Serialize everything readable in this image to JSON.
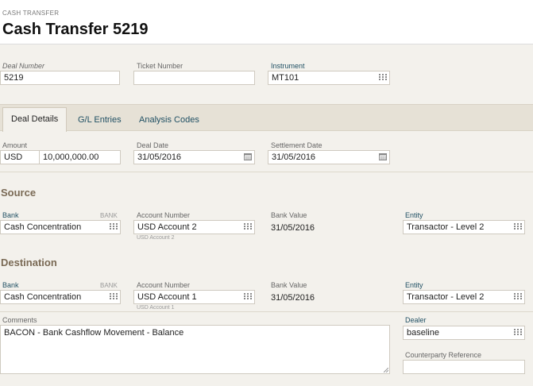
{
  "header": {
    "kicker": "CASH TRANSFER",
    "title": "Cash Transfer 5219"
  },
  "top": {
    "deal_number": {
      "label": "Deal Number",
      "value": "5219"
    },
    "ticket_number": {
      "label": "Ticket Number",
      "value": ""
    },
    "instrument": {
      "label": "Instrument",
      "value": "MT101"
    }
  },
  "tabs": [
    "Deal Details",
    "G/L Entries",
    "Analysis Codes"
  ],
  "details": {
    "amount": {
      "label": "Amount",
      "currency": "USD",
      "value": "10,000,000.00"
    },
    "deal_date": {
      "label": "Deal Date",
      "value": "31/05/2016"
    },
    "settlement_date": {
      "label": "Settlement Date",
      "value": "31/05/2016"
    }
  },
  "source": {
    "heading": "Source",
    "bank": {
      "label": "Bank",
      "tag": "BANK",
      "value": "Cash Concentration"
    },
    "account": {
      "label": "Account Number",
      "value": "USD Account 2",
      "sub": "USD Account 2"
    },
    "bank_value": {
      "label": "Bank Value",
      "value": "31/05/2016"
    },
    "entity": {
      "label": "Entity",
      "value": "Transactor - Level 2"
    }
  },
  "destination": {
    "heading": "Destination",
    "bank": {
      "label": "Bank",
      "tag": "BANK",
      "value": "Cash Concentration"
    },
    "account": {
      "label": "Account Number",
      "value": "USD Account 1",
      "sub": "USD Account 1"
    },
    "bank_value": {
      "label": "Bank Value",
      "value": "31/05/2016"
    },
    "entity": {
      "label": "Entity",
      "value": "Transactor - Level 2"
    }
  },
  "comments": {
    "label": "Comments",
    "value": "BACON - Bank Cashflow Movement - Balance"
  },
  "dealer": {
    "label": "Dealer",
    "value": "baseline"
  },
  "counterparty": {
    "label": "Counterparty Reference",
    "value": ""
  },
  "icons": [
    "grid-icon",
    "calendar-icon"
  ]
}
